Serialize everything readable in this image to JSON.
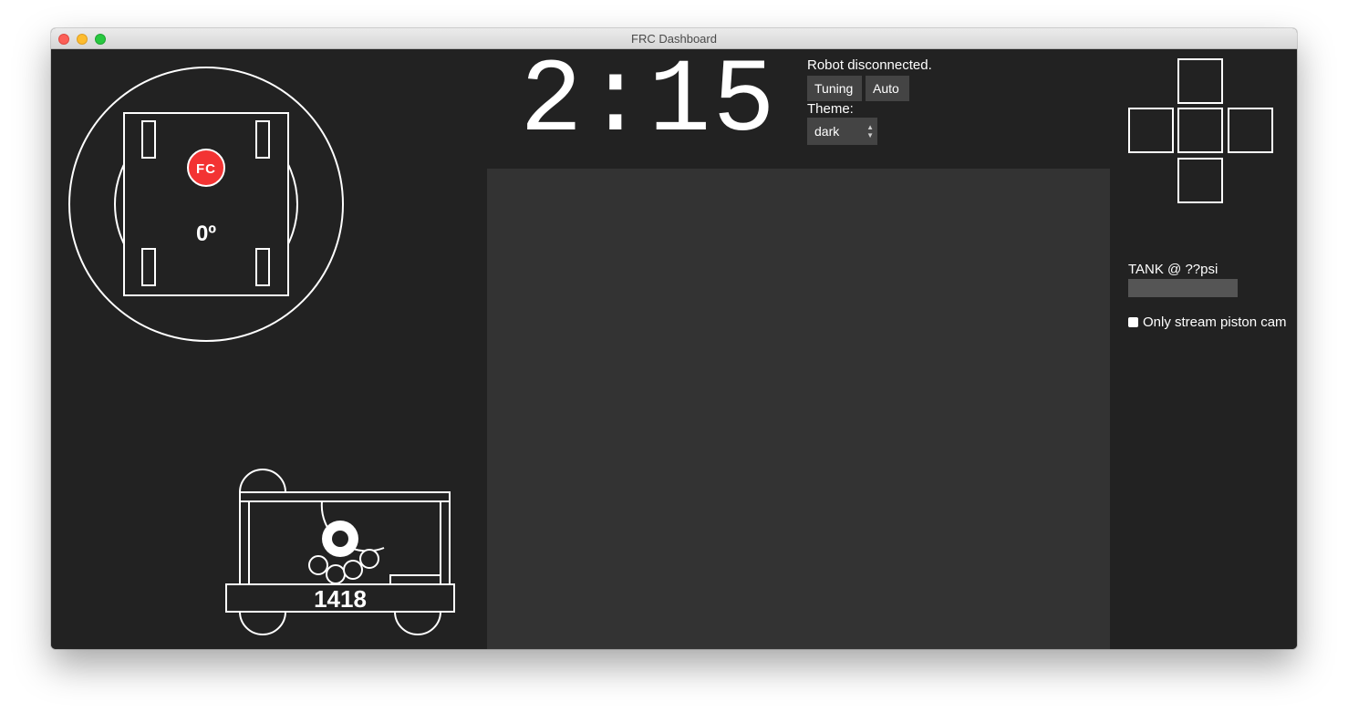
{
  "window": {
    "title": "FRC Dashboard"
  },
  "gyro": {
    "heading_text": "0º",
    "badge_text": "FC"
  },
  "robot": {
    "team_number": "1418"
  },
  "timer": {
    "text": "2:15"
  },
  "robot_status": {
    "text": "Robot disconnected."
  },
  "tabs": [
    {
      "label": "Tuning"
    },
    {
      "label": "Auto"
    }
  ],
  "theme": {
    "label": "Theme:",
    "selected": "dark"
  },
  "tank": {
    "label": "TANK @ ??psi",
    "fill_fraction": 0
  },
  "stream_option": {
    "label": "Only stream piston cam",
    "checked": false
  },
  "colors": {
    "background": "#222222",
    "camera_area": "#333333",
    "button_bg": "#444444",
    "badge_red": "#f33333",
    "stroke": "#ffffff"
  },
  "icons": {
    "close": "close-dot",
    "minimize": "minimize-dot",
    "maximize": "maximize-dot",
    "dropdown": "chevron-updown-icon"
  }
}
